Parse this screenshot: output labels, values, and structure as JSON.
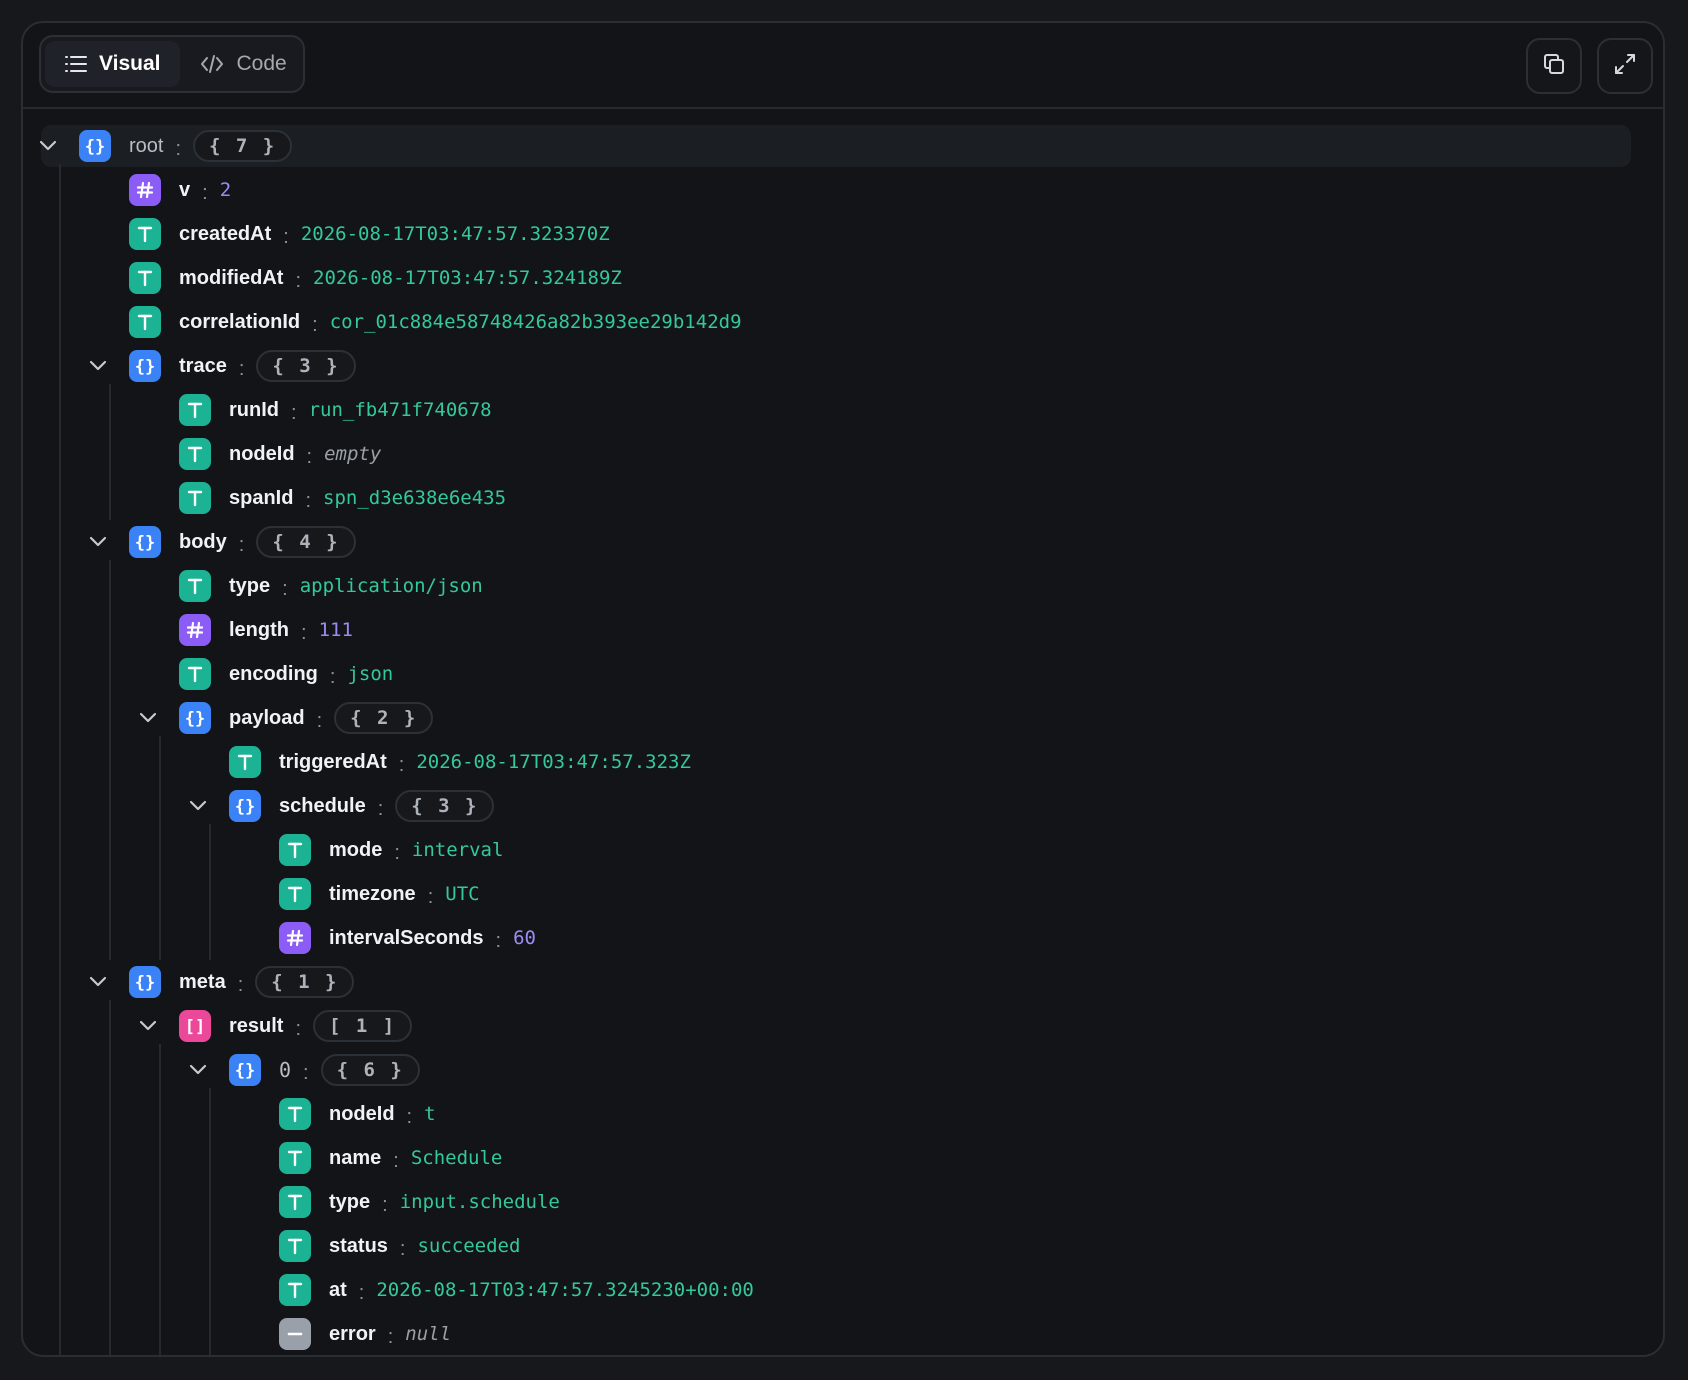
{
  "toolbar": {
    "tabs": [
      {
        "label": "Visual",
        "icon": "list-icon",
        "active": true
      },
      {
        "label": "Code",
        "icon": "code-icon",
        "active": false
      }
    ],
    "actions": [
      {
        "name": "copy-button",
        "icon": "copy-icon"
      },
      {
        "name": "expand-button",
        "icon": "expand-icon"
      }
    ]
  },
  "colors": {
    "object": "#3b82f6",
    "string": "#1bb394",
    "number": "#8b5cf6",
    "array": "#ec4899",
    "null": "#9aa0aa",
    "string_value": "#34c89a",
    "number_value": "#9b8cf5"
  },
  "tree": [
    {
      "depth": 0,
      "kind": "object",
      "key": "root",
      "count": "{ 7 }",
      "expanded": true
    },
    {
      "depth": 1,
      "kind": "number",
      "key": "v",
      "value": "2"
    },
    {
      "depth": 1,
      "kind": "string",
      "key": "createdAt",
      "value": "2026-08-17T03:47:57.323370Z"
    },
    {
      "depth": 1,
      "kind": "string",
      "key": "modifiedAt",
      "value": "2026-08-17T03:47:57.324189Z"
    },
    {
      "depth": 1,
      "kind": "string",
      "key": "correlationId",
      "value": "cor_01c884e58748426a82b393ee29b142d9"
    },
    {
      "depth": 1,
      "kind": "object",
      "key": "trace",
      "count": "{ 3 }",
      "expanded": true
    },
    {
      "depth": 2,
      "kind": "string",
      "key": "runId",
      "value": "run_fb471f740678"
    },
    {
      "depth": 2,
      "kind": "empty",
      "key": "nodeId",
      "value": "empty"
    },
    {
      "depth": 2,
      "kind": "string",
      "key": "spanId",
      "value": "spn_d3e638e6e435"
    },
    {
      "depth": 1,
      "kind": "object",
      "key": "body",
      "count": "{ 4 }",
      "expanded": true
    },
    {
      "depth": 2,
      "kind": "string",
      "key": "type",
      "value": "application/json"
    },
    {
      "depth": 2,
      "kind": "number",
      "key": "length",
      "value": "111"
    },
    {
      "depth": 2,
      "kind": "string",
      "key": "encoding",
      "value": "json"
    },
    {
      "depth": 2,
      "kind": "object",
      "key": "payload",
      "count": "{ 2 }",
      "expanded": true
    },
    {
      "depth": 3,
      "kind": "string",
      "key": "triggeredAt",
      "value": "2026-08-17T03:47:57.323Z"
    },
    {
      "depth": 3,
      "kind": "object",
      "key": "schedule",
      "count": "{ 3 }",
      "expanded": true
    },
    {
      "depth": 4,
      "kind": "string",
      "key": "mode",
      "value": "interval"
    },
    {
      "depth": 4,
      "kind": "string",
      "key": "timezone",
      "value": "UTC"
    },
    {
      "depth": 4,
      "kind": "number",
      "key": "intervalSeconds",
      "value": "60"
    },
    {
      "depth": 1,
      "kind": "object",
      "key": "meta",
      "count": "{ 1 }",
      "expanded": true
    },
    {
      "depth": 2,
      "kind": "array",
      "key": "result",
      "count": "[ 1 ]",
      "expanded": true
    },
    {
      "depth": 3,
      "kind": "object",
      "key": "0",
      "count": "{ 6 }",
      "expanded": true
    },
    {
      "depth": 4,
      "kind": "string",
      "key": "nodeId",
      "value": "t"
    },
    {
      "depth": 4,
      "kind": "string",
      "key": "name",
      "value": "Schedule"
    },
    {
      "depth": 4,
      "kind": "string",
      "key": "type",
      "value": "input.schedule"
    },
    {
      "depth": 4,
      "kind": "string",
      "key": "status",
      "value": "succeeded"
    },
    {
      "depth": 4,
      "kind": "string",
      "key": "at",
      "value": "2026-08-17T03:47:57.3245230+00:00"
    },
    {
      "depth": 4,
      "kind": "null",
      "key": "error",
      "value": "null"
    }
  ]
}
